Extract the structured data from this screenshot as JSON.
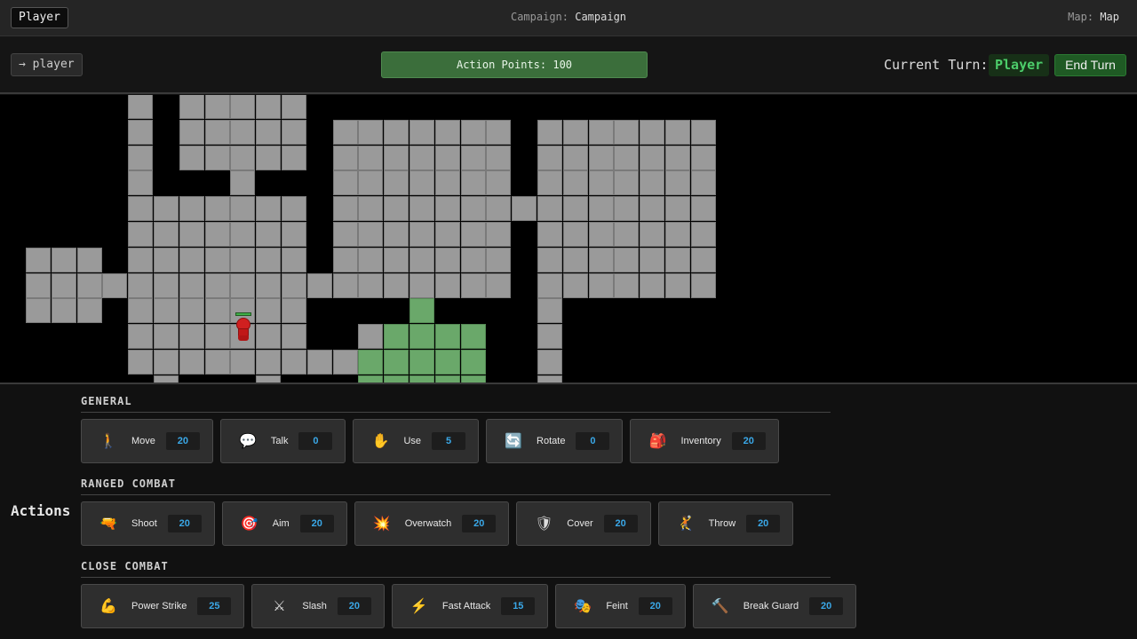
{
  "topbar": {
    "player_button": "Player",
    "campaign_label": "Campaign:",
    "campaign_value": "Campaign",
    "map_label": "Map:",
    "map_value": "Map"
  },
  "status": {
    "player_link": "→ player",
    "action_points": "Action Points: 100",
    "current_turn_label": "Current Turn:",
    "current_turn_value": "Player",
    "end_turn": "End Turn"
  },
  "colors": {
    "floor": "#9a9a9a",
    "move_range": "#6aa86a",
    "unit": "#d02020",
    "cost": "#3aa8e8",
    "end_turn": "#1f5a24"
  },
  "actions": {
    "title": "Actions",
    "general": {
      "title": "GENERAL",
      "items": [
        {
          "icon": "walk-icon",
          "glyph": "🚶",
          "label": "Move",
          "cost": "20"
        },
        {
          "icon": "speech-bubble-icon",
          "glyph": "💬",
          "label": "Talk",
          "cost": "0"
        },
        {
          "icon": "hand-icon",
          "glyph": "✋",
          "label": "Use",
          "cost": "5"
        },
        {
          "icon": "rotate-icon",
          "glyph": "🔄",
          "label": "Rotate",
          "cost": "0"
        },
        {
          "icon": "backpack-icon",
          "glyph": "🎒",
          "label": "Inventory",
          "cost": "20"
        }
      ]
    },
    "ranged": {
      "title": "RANGED COMBAT",
      "items": [
        {
          "icon": "gun-icon",
          "glyph": "🔫",
          "label": "Shoot",
          "cost": "20"
        },
        {
          "icon": "target-icon",
          "glyph": "🎯",
          "label": "Aim",
          "cost": "20"
        },
        {
          "icon": "burst-icon",
          "glyph": "💥",
          "label": "Overwatch",
          "cost": "20"
        },
        {
          "icon": "shield-icon",
          "glyph": "🛡",
          "label": "Cover",
          "cost": "20"
        },
        {
          "icon": "throw-icon",
          "glyph": "🤾",
          "label": "Throw",
          "cost": "20"
        }
      ]
    },
    "close": {
      "title": "CLOSE COMBAT",
      "items": [
        {
          "icon": "flexed-arm-icon",
          "glyph": "💪",
          "label": "Power Strike",
          "cost": "25"
        },
        {
          "icon": "crossed-swords-icon",
          "glyph": "⚔",
          "label": "Slash",
          "cost": "20"
        },
        {
          "icon": "lightning-icon",
          "glyph": "⚡",
          "label": "Fast Attack",
          "cost": "15"
        },
        {
          "icon": "masks-icon",
          "glyph": "🎭",
          "label": "Feint",
          "cost": "20"
        },
        {
          "icon": "hammer-icon",
          "glyph": "🔨",
          "label": "Break Guard",
          "cost": "20"
        }
      ]
    }
  }
}
